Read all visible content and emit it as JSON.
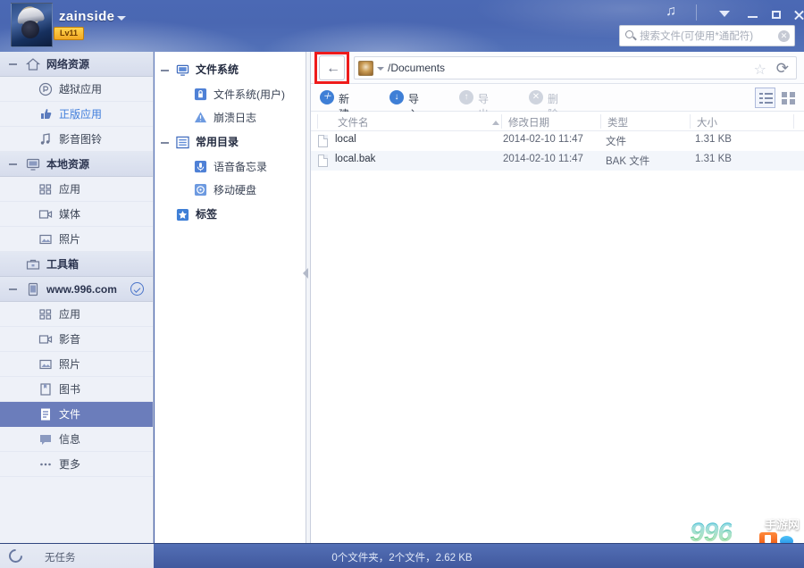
{
  "header": {
    "username": "zainside",
    "level_badge": "Lv11",
    "icons": {
      "music": "♫",
      "chevron": "chevron-down-icon",
      "minimize": "minimize-icon",
      "maximize": "maximize-icon",
      "close": "close-icon"
    }
  },
  "search": {
    "placeholder": "搜索文件(可使用*通配符)",
    "value": "",
    "clear_label": "✕"
  },
  "sidebar": {
    "groups": [
      {
        "label": "网络资源",
        "icon": "home-icon",
        "items": [
          {
            "label": "越狱应用",
            "icon": "jailbreak-icon",
            "selected": false,
            "link": false
          },
          {
            "label": "正版应用",
            "icon": "thumb-icon",
            "selected": false,
            "link": true
          },
          {
            "label": "影音图铃",
            "icon": "music-note-icon",
            "selected": false,
            "link": false
          }
        ]
      },
      {
        "label": "本地资源",
        "icon": "monitor-icon",
        "items": [
          {
            "label": "应用",
            "icon": "apps-grid-icon",
            "selected": false,
            "link": false
          },
          {
            "label": "媒体",
            "icon": "video-icon",
            "selected": false,
            "link": false
          },
          {
            "label": "照片",
            "icon": "photo-icon",
            "selected": false,
            "link": false
          }
        ]
      },
      {
        "label": "工具箱",
        "icon": "toolbox-icon",
        "items": []
      },
      {
        "label": "www.996.com",
        "icon": "device-icon",
        "verified": true,
        "items": [
          {
            "label": "应用",
            "icon": "apps-grid-icon",
            "selected": false,
            "link": false
          },
          {
            "label": "影音",
            "icon": "video-icon",
            "selected": false,
            "link": false
          },
          {
            "label": "照片",
            "icon": "photo-icon",
            "selected": false,
            "link": false
          },
          {
            "label": "图书",
            "icon": "book-icon",
            "selected": false,
            "link": false
          },
          {
            "label": "文件",
            "icon": "file-doc-icon",
            "selected": true,
            "link": false
          },
          {
            "label": "信息",
            "icon": "message-icon",
            "selected": false,
            "link": false
          },
          {
            "label": "更多",
            "icon": "more-dots-icon",
            "selected": false,
            "link": false
          }
        ]
      }
    ]
  },
  "midcol": {
    "sections": [
      {
        "label": "文件系统",
        "icon": "monitor-icon",
        "items": [
          {
            "label": "文件系统(用户)",
            "icon": "lock-icon"
          },
          {
            "label": "崩溃日志",
            "icon": "warning-icon"
          }
        ]
      },
      {
        "label": "常用目录",
        "icon": "list-icon",
        "items": [
          {
            "label": "语音备忘录",
            "icon": "mic-icon"
          },
          {
            "label": "移动硬盘",
            "icon": "drive-icon"
          }
        ]
      },
      {
        "label": "标签",
        "icon": "star-icon",
        "items": []
      }
    ]
  },
  "address": {
    "back_glyph": "←",
    "path": "/Documents",
    "device_icon": "device-avatar-icon",
    "star_glyph": "☆",
    "refresh_glyph": "⟳"
  },
  "toolbar": {
    "buttons": [
      {
        "label": "新建",
        "glyph": "＋",
        "enabled": true
      },
      {
        "label": "导入",
        "glyph": "↓",
        "enabled": true
      },
      {
        "label": "导出",
        "glyph": "↑",
        "enabled": false
      },
      {
        "label": "删除",
        "glyph": "✕",
        "enabled": false
      }
    ],
    "view_list_active": true,
    "view_grid_active": false
  },
  "filelist": {
    "columns": [
      "文件名",
      "修改日期",
      "类型",
      "大小"
    ],
    "sort_column": "文件名",
    "sort_dir": "asc",
    "rows": [
      {
        "name": "local",
        "date": "2014-02-10 11:47",
        "type": "文件",
        "size": "1.31 KB"
      },
      {
        "name": "local.bak",
        "date": "2014-02-10 11:47",
        "type": "BAK 文件",
        "size": "1.31 KB"
      }
    ]
  },
  "statusbar": {
    "task_text": "无任务",
    "summary": "0个文件夹，2个文件，2.62 KB"
  },
  "watermark": {
    "number": "996",
    "text": "手游网"
  }
}
